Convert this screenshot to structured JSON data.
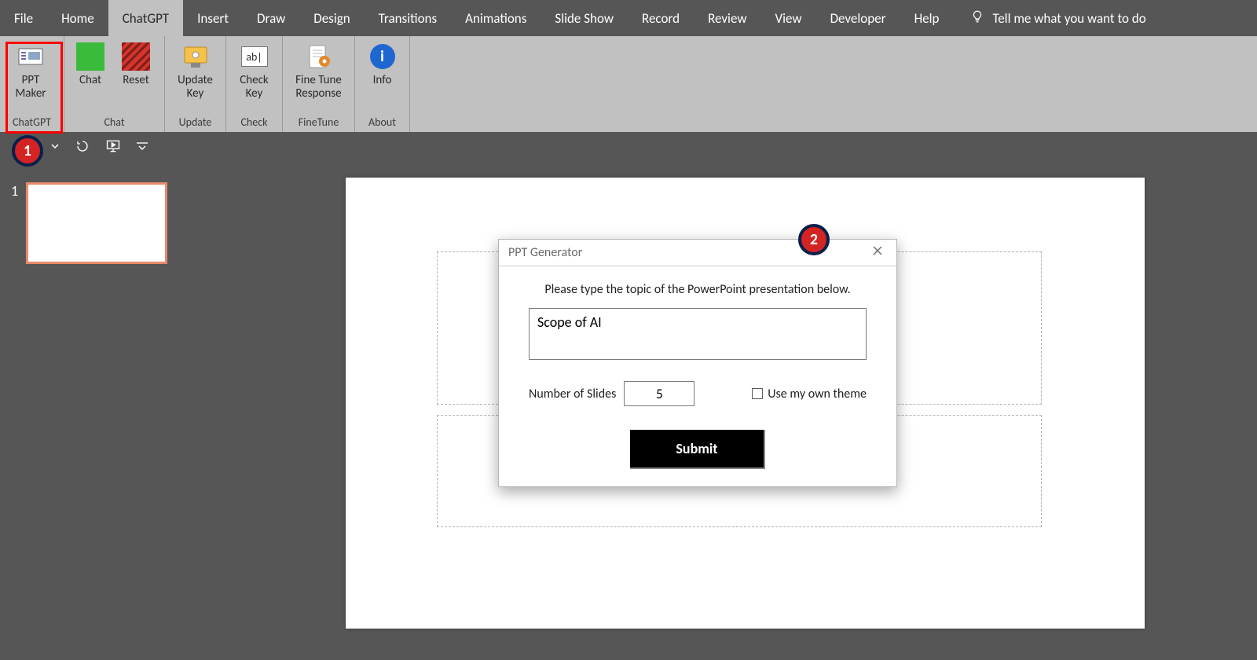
{
  "tabs": [
    "File",
    "Home",
    "ChatGPT",
    "Insert",
    "Draw",
    "Design",
    "Transitions",
    "Animations",
    "Slide Show",
    "Record",
    "Review",
    "View",
    "Developer",
    "Help"
  ],
  "active_tab": "ChatGPT",
  "tellme": "Tell me what you want to do",
  "ribbon": {
    "groups": [
      {
        "label": "ChatGPT",
        "buttons": [
          {
            "name": "ppt-maker",
            "label": "PPT\nMaker",
            "icon": "list-card"
          }
        ]
      },
      {
        "label": "Chat",
        "buttons": [
          {
            "name": "chat",
            "label": "Chat",
            "icon": "green-square"
          },
          {
            "name": "reset",
            "label": "Reset",
            "icon": "red-hatch"
          }
        ]
      },
      {
        "label": "Update",
        "buttons": [
          {
            "name": "update-key",
            "label": "Update\nKey",
            "icon": "key-card"
          }
        ]
      },
      {
        "label": "Check",
        "buttons": [
          {
            "name": "check-key",
            "label": "Check\nKey",
            "icon": "abl"
          }
        ]
      },
      {
        "label": "FineTune",
        "buttons": [
          {
            "name": "fine-tune",
            "label": "Fine Tune\nResponse",
            "icon": "gear-page"
          }
        ]
      },
      {
        "label": "About",
        "buttons": [
          {
            "name": "info",
            "label": "Info",
            "icon": "info"
          }
        ]
      }
    ]
  },
  "thumbnails": {
    "slide_number": "1"
  },
  "dialog": {
    "title": "PPT Generator",
    "instruction": "Please type the topic of the PowerPoint presentation below.",
    "topic_value": "Scope of AI",
    "num_label": "Number of Slides",
    "num_value": "5",
    "theme_label": "Use my own theme",
    "theme_checked": false,
    "submit": "Submit"
  },
  "annotations": {
    "step1": "1",
    "step2": "2"
  }
}
